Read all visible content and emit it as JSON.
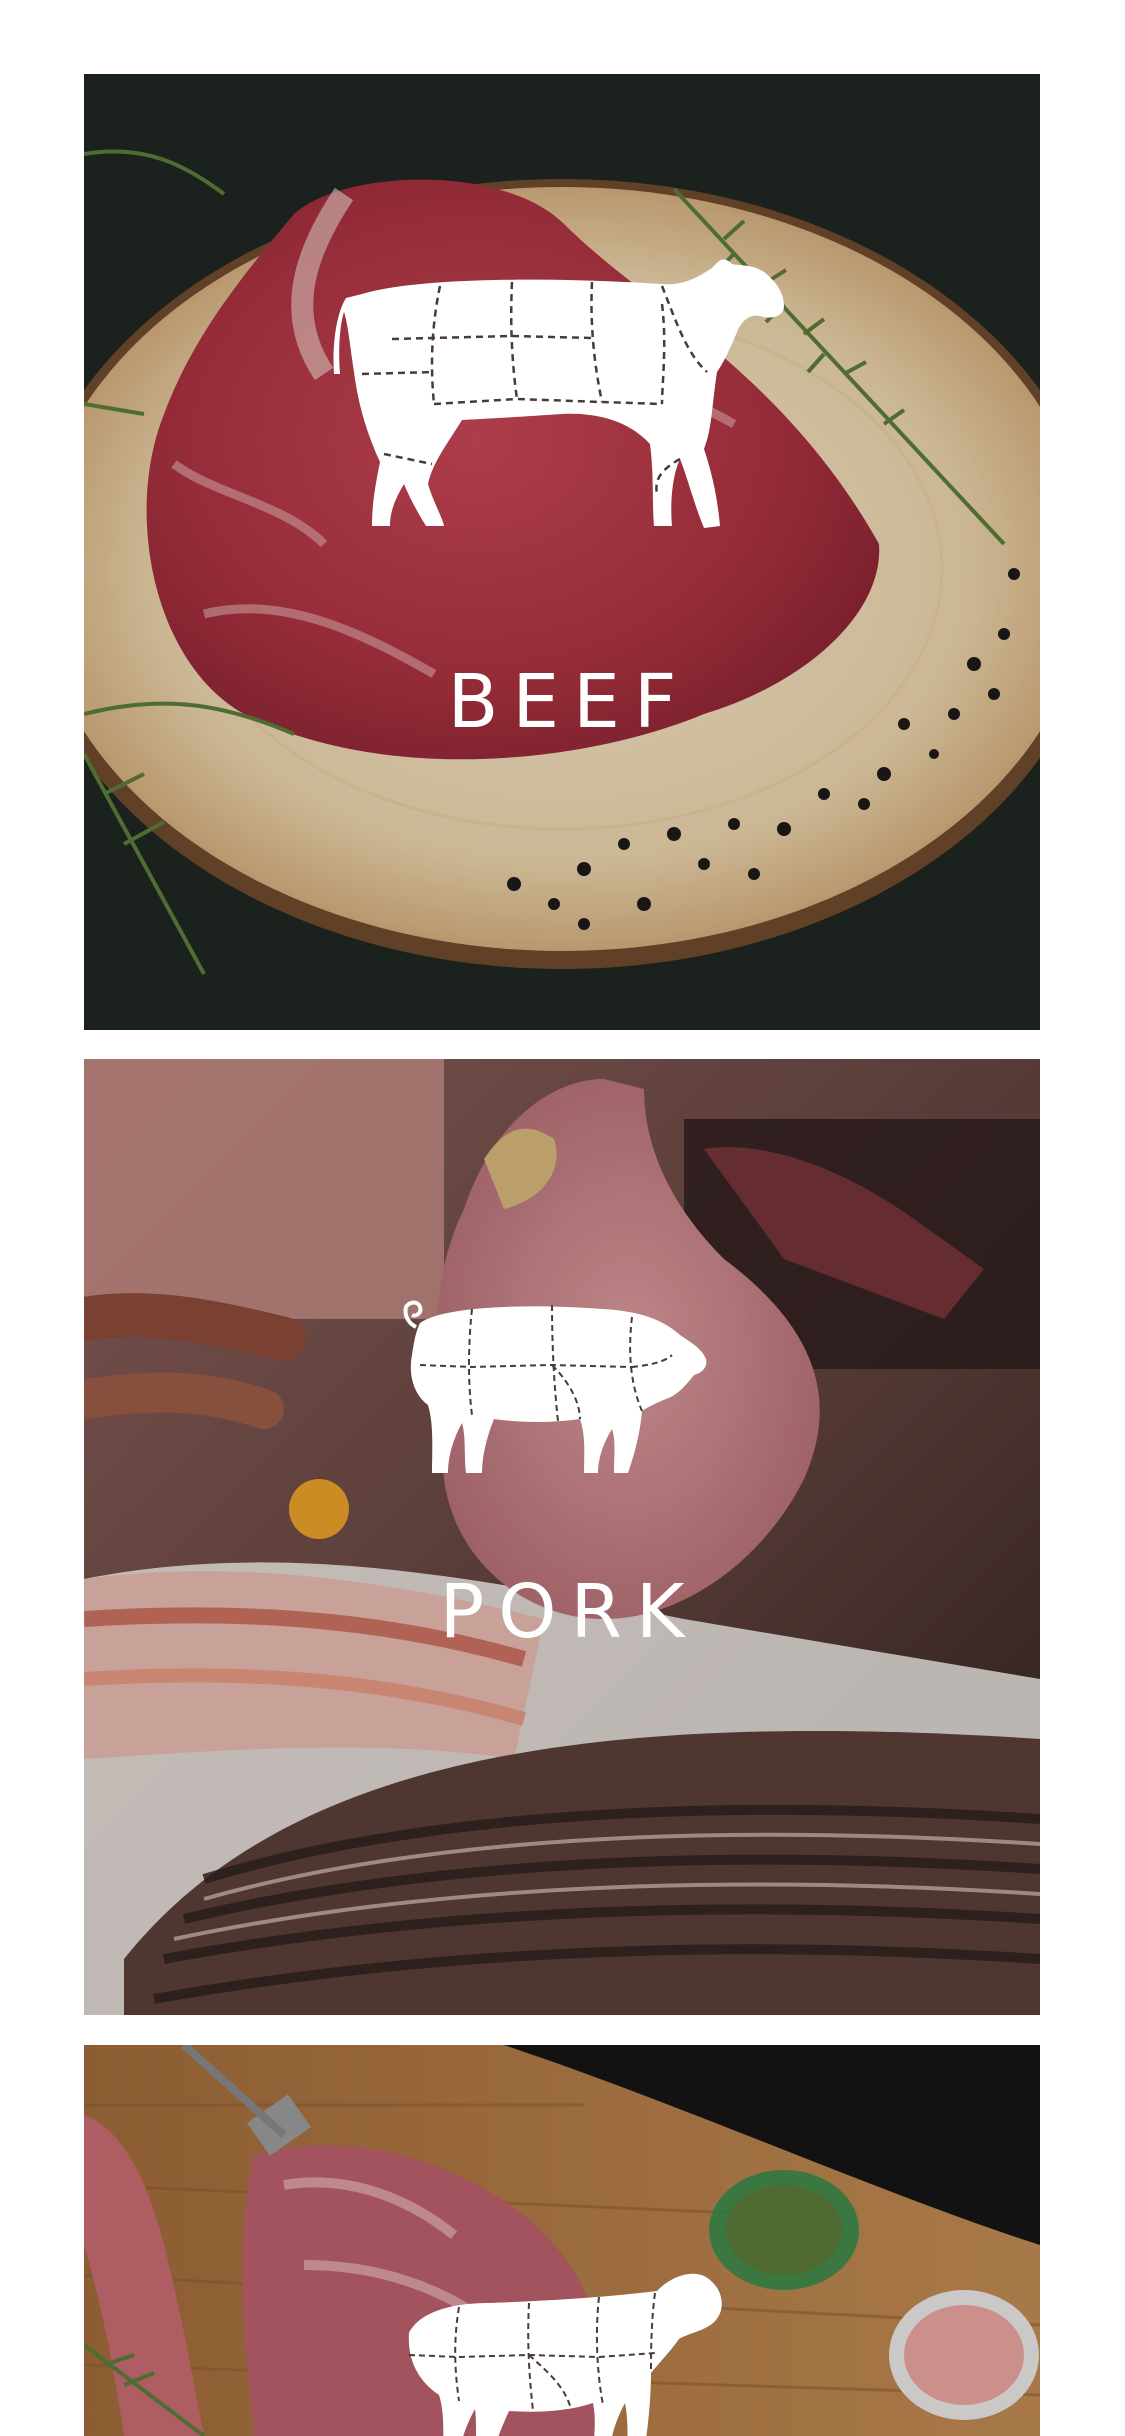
{
  "categories": [
    {
      "id": "beef",
      "label": "BEEF",
      "icon": "cow-icon"
    },
    {
      "id": "pork",
      "label": "PORK",
      "icon": "pig-icon"
    },
    {
      "id": "lamb",
      "label": "",
      "icon": "lamb-icon"
    }
  ],
  "colors": {
    "background": "#ffffff",
    "label_text": "#ffffff",
    "icon_fill": "#ffffff",
    "icon_cut_lines": "#4a3a3a"
  }
}
